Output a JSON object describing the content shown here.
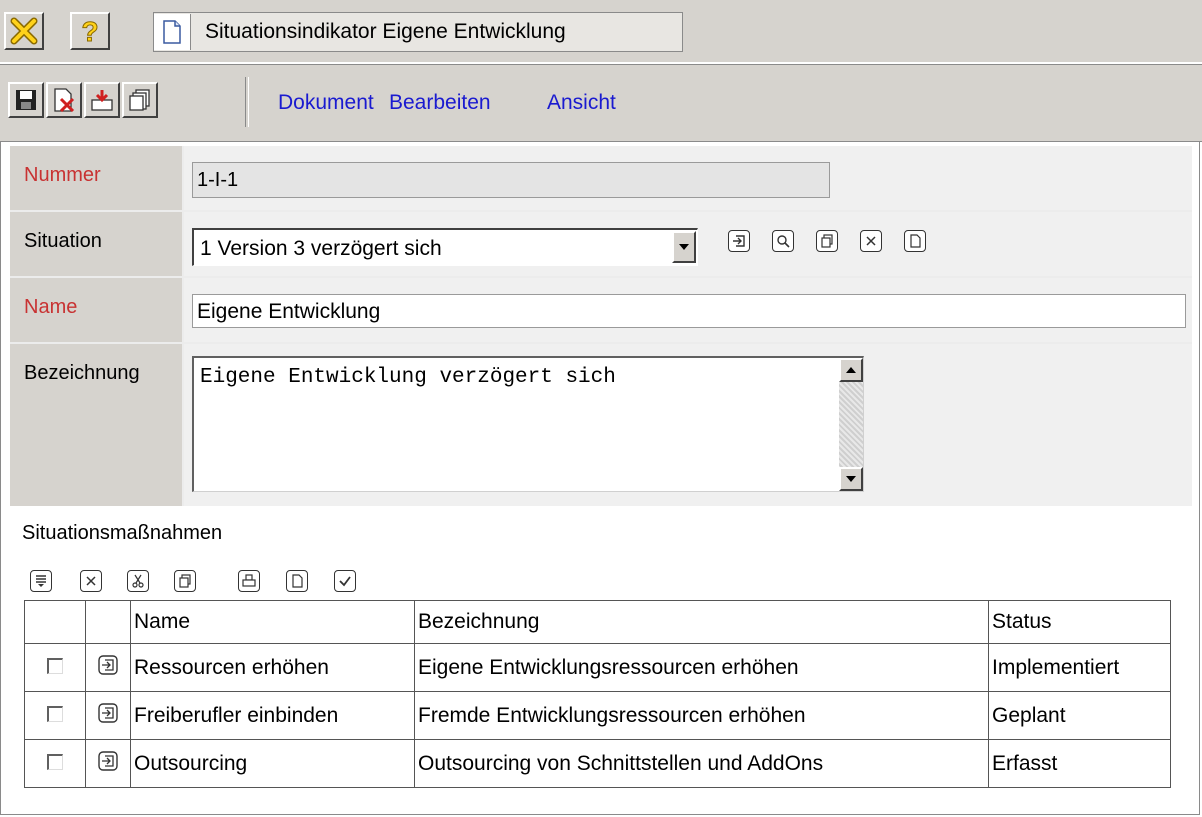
{
  "window": {
    "close_icon": "close-x-icon",
    "help_icon": "help-question-icon",
    "tab_title": "Situationsindikator Eigene Entwicklung"
  },
  "toolbar": {
    "buttons": [
      "save-icon",
      "delete-document-icon",
      "export-icon",
      "copy-pages-icon"
    ],
    "menu": [
      "Dokument",
      "Bearbeiten",
      "Ansicht"
    ]
  },
  "form": {
    "nummer": {
      "label": "Nummer",
      "value": "1-I-1"
    },
    "situation": {
      "label": "Situation",
      "selected": "1 Version 3 verzögert sich",
      "actions": [
        "open-icon",
        "search-icon",
        "copy-icon",
        "clear-icon",
        "new-document-icon"
      ]
    },
    "name": {
      "label": "Name",
      "value": "Eigene Entwicklung"
    },
    "bezeichnung": {
      "label": "Bezeichnung",
      "value": "Eigene Entwicklung verzögert sich"
    }
  },
  "measures": {
    "title": "Situationsmaßnahmen",
    "tools": [
      "insert-icon",
      "delete-icon",
      "cut-icon",
      "copy-icon",
      "print-icon",
      "new-icon",
      "check-icon"
    ],
    "columns": [
      "Name",
      "Bezeichnung",
      "Status"
    ],
    "rows": [
      {
        "name": "Ressourcen erhöhen",
        "bezeichnung": "Eigene Entwicklungsressourcen erhöhen",
        "status": "Implementiert"
      },
      {
        "name": "Freiberufler einbinden",
        "bezeichnung": "Fremde Entwicklungsressourcen erhöhen",
        "status": "Geplant"
      },
      {
        "name": "Outsourcing",
        "bezeichnung": "Outsourcing von Schnittstellen und AddOns",
        "status": "Erfasst"
      }
    ]
  },
  "colors": {
    "chrome": "#d6d3ce",
    "required_label": "#c83232",
    "menu_link": "#1a1ad0"
  }
}
